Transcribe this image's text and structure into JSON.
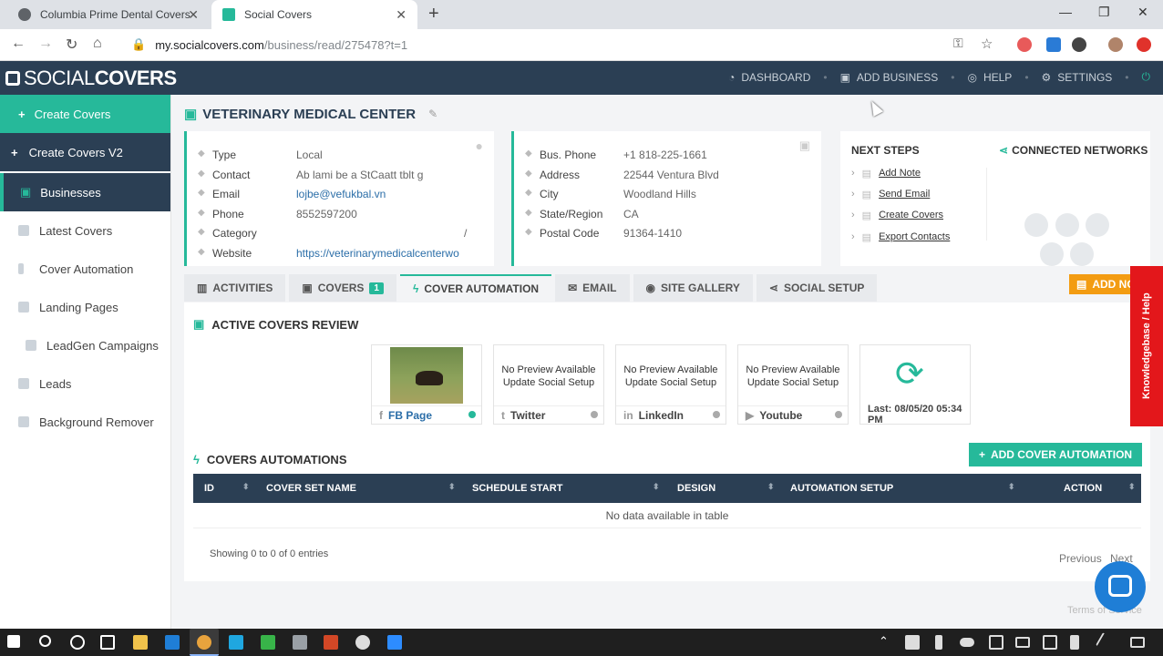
{
  "browser": {
    "tabs": [
      {
        "title": "Columbia Prime Dental Covers"
      },
      {
        "title": "Social Covers"
      }
    ],
    "url_host": "my.socialcovers.com",
    "url_path": "/business/read/275478?t=1"
  },
  "app": {
    "logo_light": "SOCIAL",
    "logo_bold": "COVERS",
    "topnav": [
      "DASHBOARD",
      "ADD BUSINESS",
      "HELP",
      "SETTINGS"
    ]
  },
  "sidebar": {
    "create": "Create Covers",
    "create_v2": "Create Covers V2",
    "businesses": "Businesses",
    "items": [
      "Latest Covers",
      "Cover Automation",
      "Landing Pages",
      "LeadGen Campaigns",
      "Leads",
      "Background Remover"
    ]
  },
  "business": {
    "title": "VETERINARY MEDICAL CENTER",
    "left": [
      {
        "label": "Type",
        "value": "Local"
      },
      {
        "label": "Contact",
        "value": "Ab  lami be a StCaatt  tblt g"
      },
      {
        "label": "Email",
        "value": "lojbe@vefukbal.vn"
      },
      {
        "label": "Phone",
        "value": "8552597200"
      },
      {
        "label": "Category",
        "value": "/"
      },
      {
        "label": "Website",
        "value": "https://veterinarymedicalcenterwo"
      }
    ],
    "right": [
      {
        "label": "Bus. Phone",
        "value": "+1 818-225-1661"
      },
      {
        "label": "Address",
        "value": "22544 Ventura Blvd"
      },
      {
        "label": "City",
        "value": "Woodland Hills"
      },
      {
        "label": "State/Region",
        "value": "CA"
      },
      {
        "label": "Postal Code",
        "value": "91364-1410"
      }
    ]
  },
  "next_steps": {
    "title": "NEXT STEPS",
    "items": [
      "Add Note",
      "Send Email",
      "Create Covers",
      "Export Contacts"
    ],
    "networks_title": "CONNECTED NETWORKS"
  },
  "tabs": {
    "activities": "ACTIVITIES",
    "covers": "COVERS",
    "covers_count": "1",
    "automation": "COVER AUTOMATION",
    "email": "EMAIL",
    "gallery": "SITE GALLERY",
    "social": "SOCIAL SETUP",
    "add_note": "ADD NO"
  },
  "review": {
    "title": "ACTIVE COVERS REVIEW",
    "no_preview_1": "No Preview Available",
    "no_preview_2": "Update Social Setup",
    "cards": [
      "FB Page",
      "Twitter",
      "LinkedIn",
      "Youtube"
    ],
    "last": "Last: 08/05/20 05:34 PM"
  },
  "automations": {
    "title": "COVERS AUTOMATIONS",
    "add_button": "ADD COVER AUTOMATION",
    "columns": [
      "ID",
      "COVER SET NAME",
      "SCHEDULE START",
      "DESIGN",
      "AUTOMATION SETUP",
      "ACTION"
    ],
    "empty": "No data available in table",
    "showing": "Showing 0 to 0 of 0 entries",
    "prev": "Previous",
    "next": "Next"
  },
  "knowledgebase": "Knowledgebase / Help",
  "footer": "Terms of Service",
  "colors": {
    "primary": "#26b99a",
    "navy": "#2b3f54",
    "orange": "#f39c12",
    "red": "#e3171b"
  }
}
